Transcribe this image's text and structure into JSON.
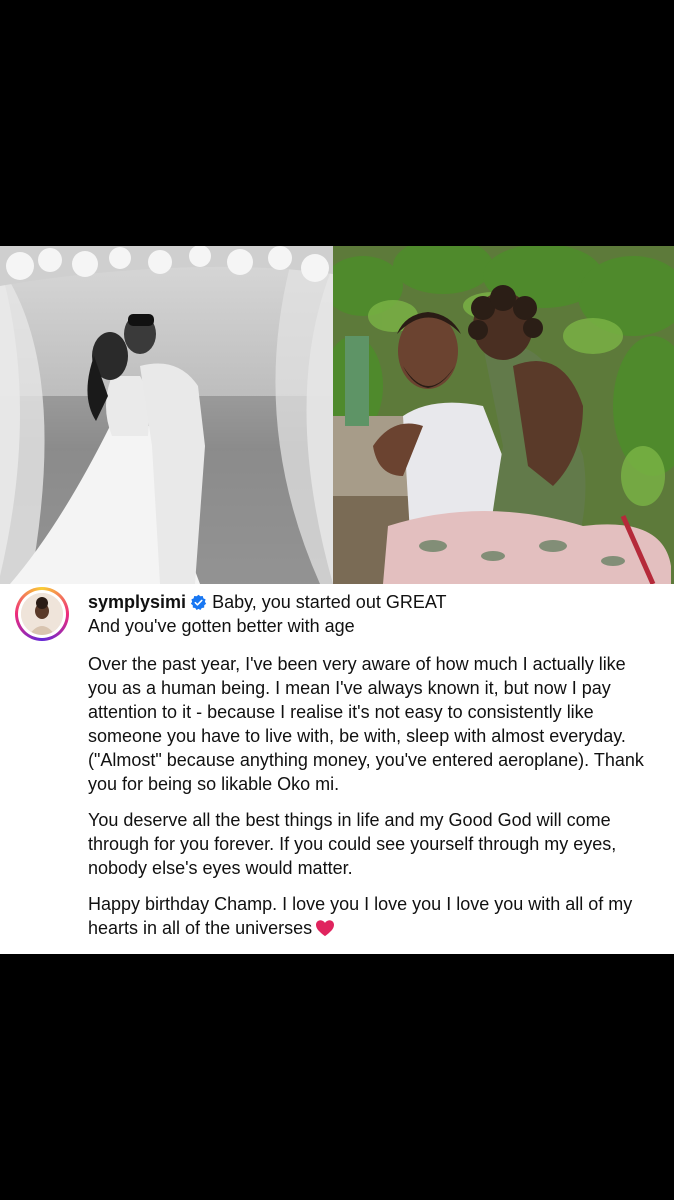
{
  "post": {
    "username": "symplysimi",
    "verified_icon": "verified-badge-icon",
    "headline": "Baby, you started out GREAT",
    "line2": "And you've gotten better with age",
    "paragraphs": [
      "Over the past year, I've been very aware of how much I actually like you as a human being. I mean I've always known it, but now I pay attention to it - because I realise it's not easy to consistently like someone you have to live with, be with, sleep with almost everyday. (\"Almost\" because anything money, you've entered aeroplane). Thank you for being so likable Oko mi.",
      "You deserve all the best things in life and my Good God will come through for you forever. If you could see yourself through my eyes, nobody else's eyes would matter.",
      "Happy birthday Champ. I love you I love you I love you with all of my hearts in all of the universes"
    ],
    "heart_emoji": "heart-icon",
    "colors": {
      "verified": "#1877f2",
      "heart": "#e0245e",
      "text": "#111111"
    }
  },
  "photos": {
    "left": "wedding-photo-black-and-white",
    "right": "couple-embracing-outdoors"
  }
}
